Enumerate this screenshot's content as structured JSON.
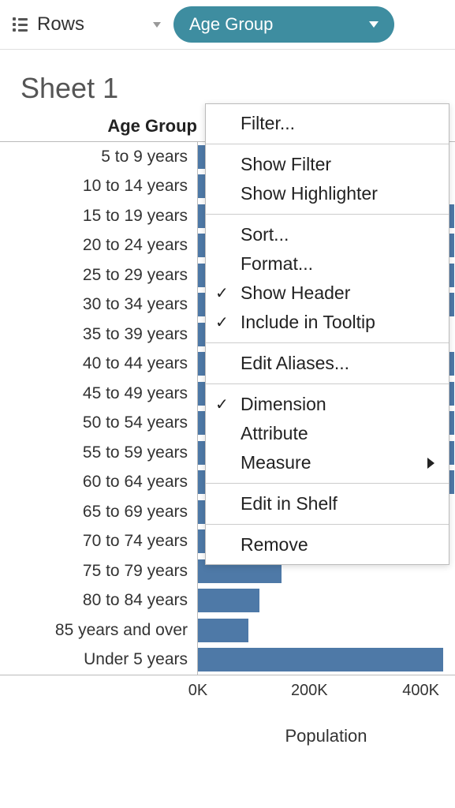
{
  "shelf": {
    "rows_label": "Rows",
    "pill_label": "Age Group"
  },
  "sheet": {
    "title": "Sheet 1",
    "column_header": "Age Group"
  },
  "context_menu": {
    "filter": "Filter...",
    "show_filter": "Show Filter",
    "show_highlighter": "Show Highlighter",
    "sort": "Sort...",
    "format": "Format...",
    "show_header": "Show Header",
    "include_in_tooltip": "Include in Tooltip",
    "edit_aliases": "Edit Aliases...",
    "dimension": "Dimension",
    "attribute": "Attribute",
    "measure": "Measure",
    "edit_in_shelf": "Edit in Shelf",
    "remove": "Remove"
  },
  "axis": {
    "ticks": [
      "0K",
      "200K",
      "400K"
    ],
    "title": "Population"
  },
  "chart_data": {
    "type": "bar",
    "title": "Sheet 1",
    "xlabel": "Population",
    "ylabel": "Age Group",
    "xlim": [
      0,
      460000
    ],
    "categories": [
      "5 to 9 years",
      "10 to 14 years",
      "15 to 19 years",
      "20 to 24 years",
      "25 to 29 years",
      "30 to 34 years",
      "35 to 39 years",
      "40 to 44 years",
      "45 to 49 years",
      "50 to 54 years",
      "55 to 59 years",
      "60 to 64 years",
      "65 to 69 years",
      "70 to 74 years",
      "75 to 79 years",
      "80 to 84 years",
      "85 years and over",
      "Under 5 years"
    ],
    "values": [
      450000,
      440000,
      460000,
      460000,
      460000,
      460000,
      430000,
      460000,
      460000,
      460000,
      460000,
      460000,
      260000,
      200000,
      150000,
      110000,
      90000,
      440000
    ]
  }
}
